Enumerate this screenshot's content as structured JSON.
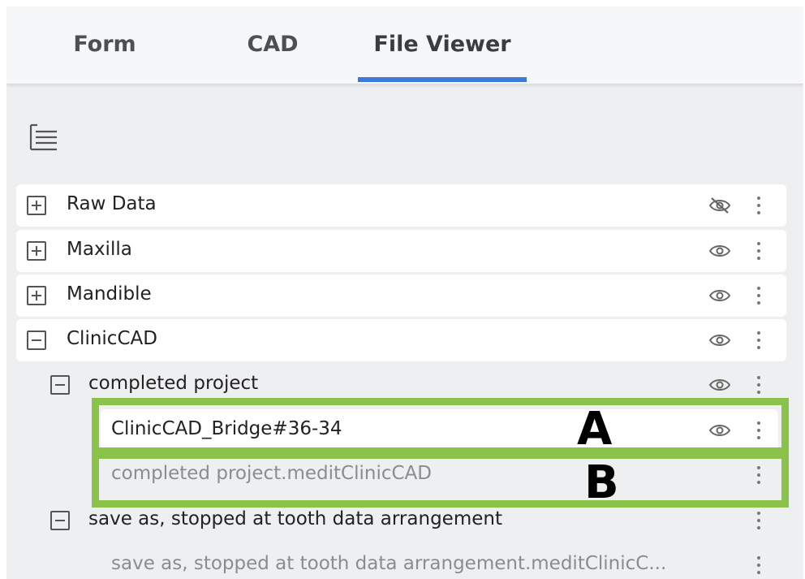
{
  "tabs": [
    {
      "label": "Form",
      "active": false
    },
    {
      "label": "CAD",
      "active": false
    },
    {
      "label": "File Viewer",
      "active": true
    }
  ],
  "colors": {
    "accent": "#3b7ad8",
    "annotation": "#8bc34a"
  },
  "tree": {
    "toggle_icon": "tree-view-icon",
    "rows": [
      {
        "label": "Raw Data",
        "expander": "plus",
        "visibility": "hidden"
      },
      {
        "label": "Maxilla",
        "expander": "plus",
        "visibility": "visible"
      },
      {
        "label": "Mandible",
        "expander": "plus",
        "visibility": "visible"
      },
      {
        "label": "ClinicCAD",
        "expander": "minus",
        "visibility": "visible"
      },
      {
        "label": "completed project",
        "expander": "minus",
        "visibility": "visible"
      },
      {
        "label": "ClinicCAD_Bridge#36-34",
        "expander": "none",
        "visibility": "visible"
      },
      {
        "label": "completed project.meditClinicCAD",
        "expander": "none",
        "visibility": "none"
      },
      {
        "label": "save as, stopped at tooth data arrangement",
        "expander": "minus",
        "visibility": "none"
      },
      {
        "label": "save as, stopped at tooth data arrangement.meditClinicC...",
        "expander": "none",
        "visibility": "none"
      }
    ]
  },
  "annotations": {
    "a": "A",
    "b": "B"
  }
}
